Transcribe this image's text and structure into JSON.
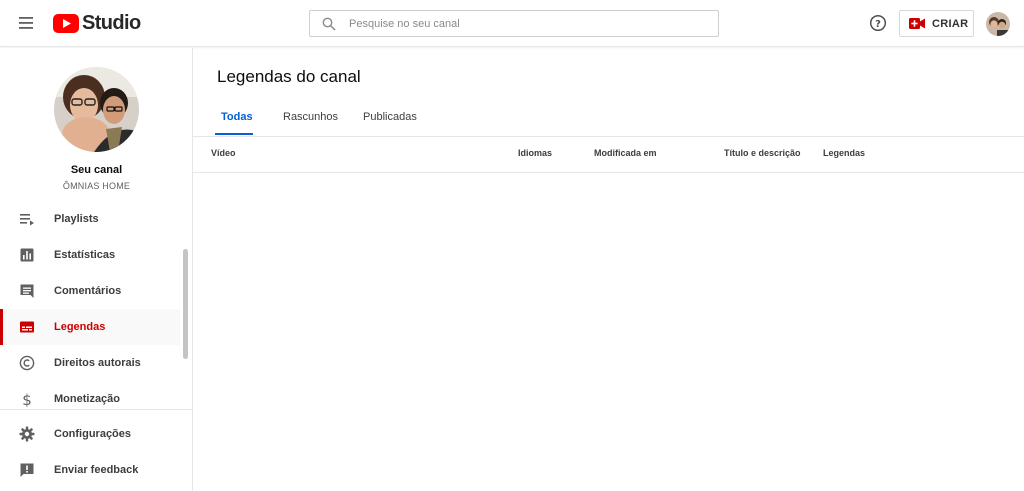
{
  "header": {
    "logo_text": "Studio",
    "search_placeholder": "Pesquise no seu canal",
    "create_label": "CRIAR",
    "colors": {
      "brand_red": "#ff0000",
      "accent_blue": "#065fd4"
    }
  },
  "sidebar": {
    "channel_title": "Seu canal",
    "channel_name": "ÔMNIAS HOME",
    "items": [
      {
        "label": "Playlists",
        "icon": "playlist-icon",
        "active": false
      },
      {
        "label": "Estatísticas",
        "icon": "analytics-icon",
        "active": false
      },
      {
        "label": "Comentários",
        "icon": "comment-icon",
        "active": false
      },
      {
        "label": "Legendas",
        "icon": "subtitles-icon",
        "active": true
      },
      {
        "label": "Direitos autorais",
        "icon": "copyright-icon",
        "active": false
      },
      {
        "label": "Monetização",
        "icon": "dollar-icon",
        "active": false
      }
    ],
    "bottom_items": [
      {
        "label": "Configurações",
        "icon": "gear-icon"
      },
      {
        "label": "Enviar feedback",
        "icon": "feedback-icon"
      }
    ]
  },
  "main": {
    "title": "Legendas do canal",
    "tabs": [
      {
        "label": "Todas",
        "active": true
      },
      {
        "label": "Rascunhos",
        "active": false
      },
      {
        "label": "Publicadas",
        "active": false
      }
    ],
    "columns": [
      "Vídeo",
      "Idiomas",
      "Modificada em",
      "Título e descrição",
      "Legendas"
    ]
  }
}
